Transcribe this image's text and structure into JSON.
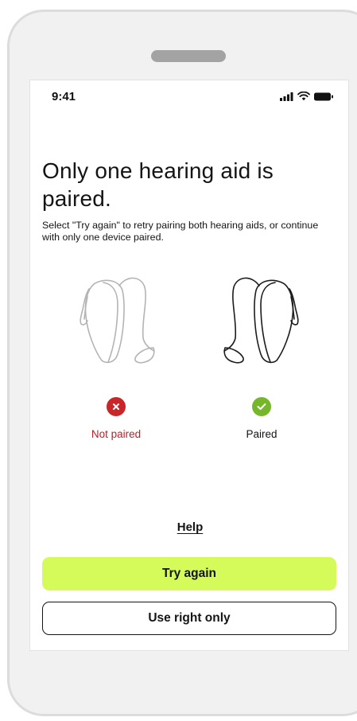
{
  "status_bar": {
    "time": "9:41",
    "icons": [
      "signal-icon",
      "wifi-icon",
      "battery-icon"
    ]
  },
  "screen": {
    "title": "Only one hearing aid is paired.",
    "description": "Select \"Try again\" to retry pairing both hearing aids, or continue with only one device paired."
  },
  "devices": {
    "left": {
      "status_label": "Not paired",
      "status_icon": "error-x-icon",
      "color": "#c8262b"
    },
    "right": {
      "status_label": "Paired",
      "status_icon": "check-icon",
      "color": "#76b62b"
    }
  },
  "actions": {
    "help_label": "Help",
    "try_again_label": "Try again",
    "use_right_only_label": "Use right only"
  },
  "colors": {
    "primary_button": "#d4fb5a",
    "error": "#c8262b",
    "success": "#76b62b"
  }
}
